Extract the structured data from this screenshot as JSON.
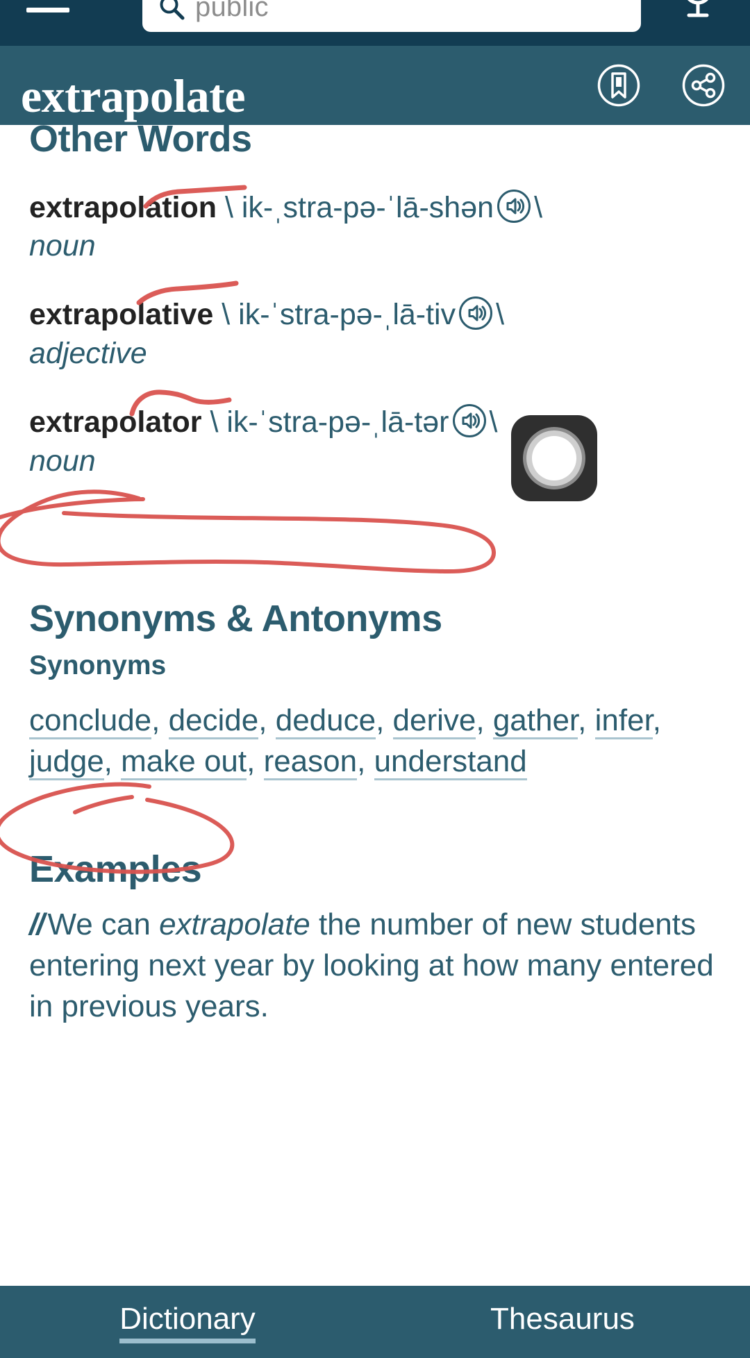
{
  "topbar": {
    "menu_icon": "hamburger-menu-icon",
    "search": {
      "icon": "search-icon",
      "value": "public",
      "placeholder": "public"
    },
    "mic_icon": "microphone-icon",
    "bg_color": "#123c52"
  },
  "word_header": {
    "headword": "extrapolate",
    "bookmark_icon": "bookmark-icon",
    "share_icon": "share-icon",
    "bg_color": "#2c5c6e"
  },
  "other_words": {
    "heading": "Other Words",
    "entries": [
      {
        "word": "extrapolation",
        "open_slash": "\\",
        "pronunciation": "ik-ˌstra-pə-ˈlā-shən",
        "audio_icon": "speaker-icon",
        "close_slash": "\\",
        "part_of_speech": "noun"
      },
      {
        "word": "extrapolative",
        "open_slash": "\\",
        "pronunciation": "ik-ˈstra-pə-ˌlā-tiv",
        "audio_icon": "speaker-icon",
        "close_slash": "\\",
        "part_of_speech": "adjective"
      },
      {
        "word": "extrapolator",
        "open_slash": "\\",
        "pronunciation": "ik-ˈstra-pə-ˌlā-tər",
        "audio_icon": "speaker-icon",
        "close_slash": "\\",
        "part_of_speech": "noun"
      }
    ]
  },
  "synonyms_antonyms": {
    "heading": "Synonyms & Antonyms",
    "subheading": "Synonyms",
    "synonyms": [
      "conclude",
      "decide",
      "deduce",
      "derive",
      "gather",
      "infer",
      "judge",
      "make out",
      "reason",
      "understand"
    ],
    "separator": ", "
  },
  "examples": {
    "heading": "Examples",
    "marker": "//",
    "sentence_before": "We can ",
    "sentence_emphasis": "extrapolate",
    "sentence_after": " the number of new students entering next year by looking at how many entered in previous years."
  },
  "record_button": {
    "name": "screen-record-floating-button"
  },
  "tabbar": {
    "tabs": [
      {
        "label": "Dictionary",
        "active": true
      },
      {
        "label": "Thesaurus",
        "active": false
      }
    ]
  },
  "annotations": {
    "ink_color": "#d9534f",
    "marks": [
      "underline-extrapolation-noun",
      "underline-extrapolative-adjective",
      "underline-extrapolator-noun",
      "circle-synonyms-antonyms-heading",
      "circle-examples-heading"
    ]
  },
  "colors": {
    "brand_dark": "#123c52",
    "brand": "#2c5c6e",
    "link_underline": "#a9c4cf",
    "ink_red": "#d9534f"
  }
}
